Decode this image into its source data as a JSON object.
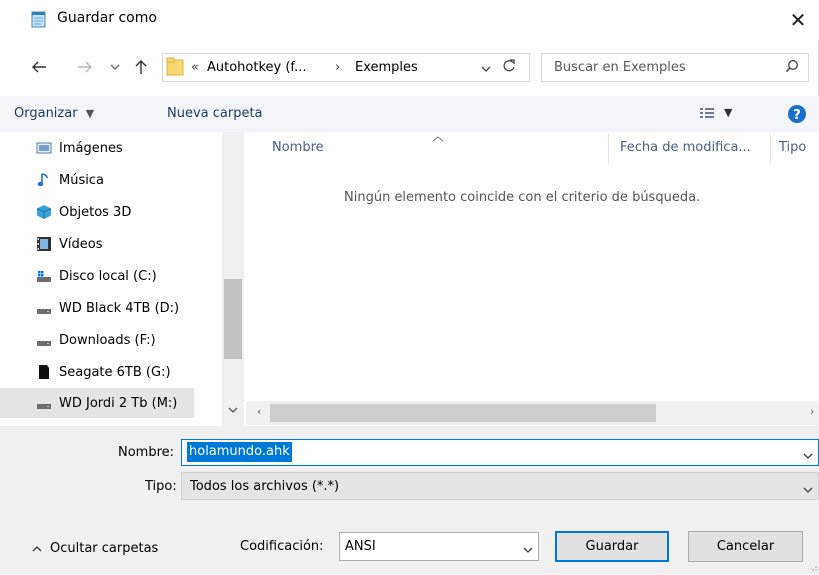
{
  "window": {
    "title": "Guardar como",
    "icon": "notepad-icon",
    "close_glyph": "✕"
  },
  "address": {
    "overflow": "«",
    "crumbs": [
      "Autohotkey (f...",
      "Exemples"
    ],
    "separator": "›"
  },
  "search": {
    "placeholder": "Buscar en Exemples"
  },
  "toolbar": {
    "organize": "Organizar",
    "new_folder": "Nueva carpeta"
  },
  "sidebar": {
    "items": [
      {
        "label": "Imágenes",
        "icon": "pictures-icon"
      },
      {
        "label": "Música",
        "icon": "music-icon"
      },
      {
        "label": "Objetos 3D",
        "icon": "3d-objects-icon"
      },
      {
        "label": "Vídeos",
        "icon": "videos-icon"
      },
      {
        "label": "Disco local (C:)",
        "icon": "system-drive-icon"
      },
      {
        "label": "WD Black 4TB (D:)",
        "icon": "drive-icon"
      },
      {
        "label": "Downloads (F:)",
        "icon": "drive-icon"
      },
      {
        "label": "Seagate 6TB (G:)",
        "icon": "usb-drive-icon"
      },
      {
        "label": "WD Jordi 2 Tb (M:)",
        "icon": "drive-icon"
      }
    ]
  },
  "columns": {
    "name": "Nombre",
    "date": "Fecha de modifica...",
    "type": "Tipo"
  },
  "empty_message": "Ningún elemento coincide con el criterio de búsqueda.",
  "form": {
    "name_label": "Nombre:",
    "name_value": "holamundo.ahk",
    "type_label": "Tipo:",
    "type_value": "Todos los archivos  (*.*)",
    "encoding_label": "Codificación:",
    "encoding_value": "ANSI",
    "hide_folders": "Ocultar carpetas",
    "save": "Guardar",
    "cancel": "Cancelar"
  },
  "colors": {
    "accent": "#0078d7",
    "selection": "#0078d7",
    "toolbar_bg": "#f3f5f8",
    "bottom_bg": "#f0f0f0"
  }
}
